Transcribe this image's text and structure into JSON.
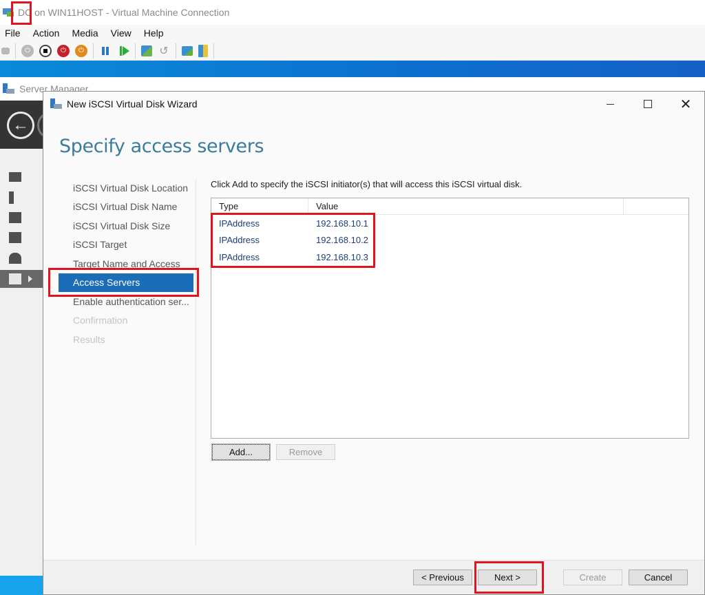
{
  "vm_window": {
    "title": "DC on WIN11HOST - Virtual Machine Connection",
    "menu": [
      "File",
      "Action",
      "Media",
      "View",
      "Help"
    ],
    "toolbar": [
      {
        "icon": "ctrl-alt-del-icon"
      },
      {
        "icon": "start-icon"
      },
      {
        "icon": "turn-off-icon"
      },
      {
        "icon": "shutdown-icon"
      },
      {
        "icon": "save-icon"
      },
      {
        "icon": "pause-icon"
      },
      {
        "icon": "resume-icon"
      },
      {
        "icon": "checkpoint-icon"
      },
      {
        "icon": "revert-icon"
      },
      {
        "icon": "enhanced-session-icon"
      },
      {
        "icon": "share-icon"
      }
    ]
  },
  "server_manager": {
    "title": "Server Manager",
    "nav_icons": [
      "dashboard-icon",
      "local-server-icon",
      "all-servers-icon",
      "file-storage-icon",
      "iis-icon",
      "file-storage-services-icon"
    ]
  },
  "wizard": {
    "title": "New iSCSI Virtual Disk Wizard",
    "heading": "Specify access servers",
    "steps": [
      {
        "label": "iSCSI Virtual Disk Location",
        "state": "done"
      },
      {
        "label": "iSCSI Virtual Disk Name",
        "state": "done"
      },
      {
        "label": "iSCSI Virtual Disk Size",
        "state": "done"
      },
      {
        "label": "iSCSI Target",
        "state": "done"
      },
      {
        "label": "Target Name and Access",
        "state": "done"
      },
      {
        "label": "Access Servers",
        "state": "active"
      },
      {
        "label": "Enable authentication ser...",
        "state": "enabled"
      },
      {
        "label": "Confirmation",
        "state": "disabled"
      },
      {
        "label": "Results",
        "state": "disabled"
      }
    ],
    "instruction": "Click Add to specify the iSCSI initiator(s) that will access this iSCSI virtual disk.",
    "table": {
      "columns": [
        "Type",
        "Value",
        ""
      ],
      "rows": [
        {
          "type": "IPAddress",
          "value": "192.168.10.1"
        },
        {
          "type": "IPAddress",
          "value": "192.168.10.2"
        },
        {
          "type": "IPAddress",
          "value": "192.168.10.3"
        }
      ]
    },
    "buttons": {
      "add": "Add...",
      "remove": "Remove",
      "previous": "< Previous",
      "next": "Next >",
      "create": "Create",
      "cancel": "Cancel"
    }
  },
  "colors": {
    "accent": "#1a6db6",
    "heading": "#3b7c9a",
    "annotation": "#e0131f",
    "row_text": "#1d3e74"
  }
}
